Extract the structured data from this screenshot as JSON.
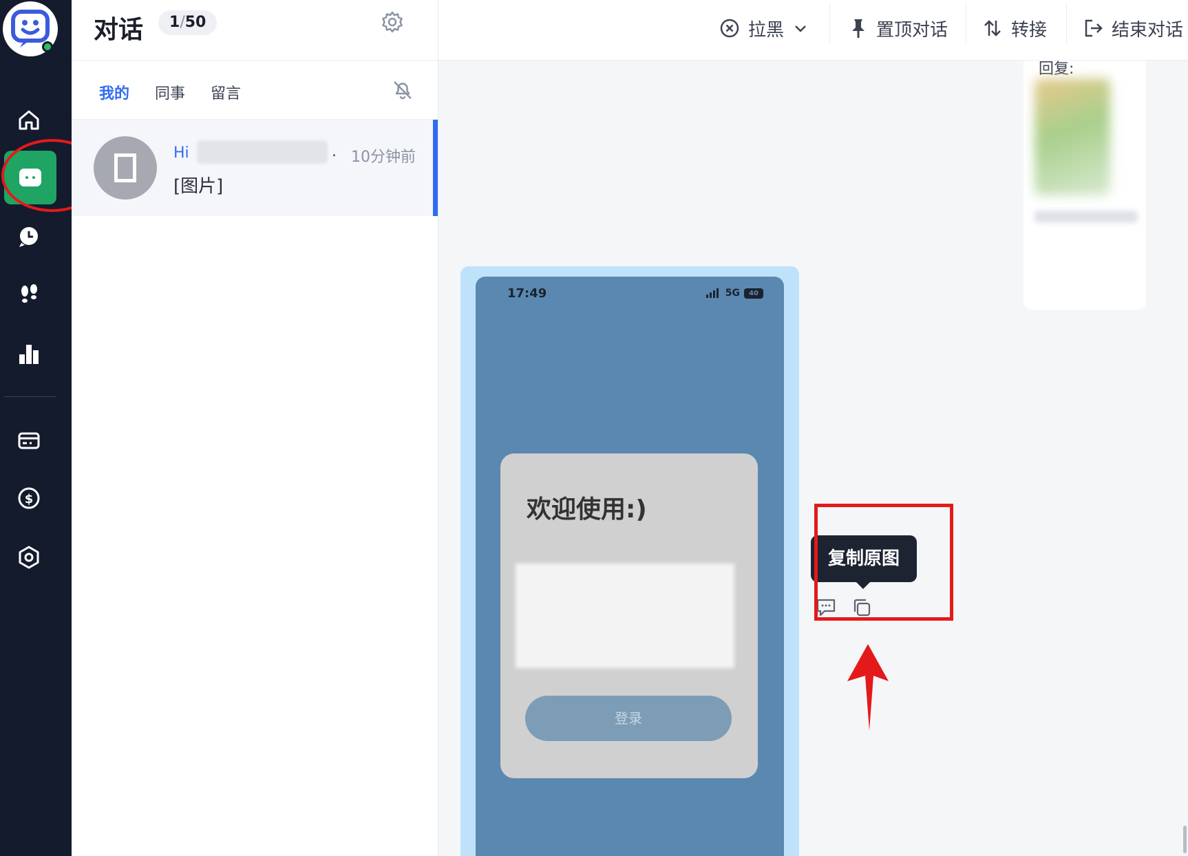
{
  "rail": {
    "logo_icon": "smiley-chat-logo",
    "items": [
      {
        "icon": "home-icon"
      },
      {
        "icon": "chat-icon",
        "active": true
      },
      {
        "icon": "history-icon"
      },
      {
        "icon": "footprints-icon"
      },
      {
        "icon": "bar-chart-icon"
      },
      {
        "icon": "card-icon"
      },
      {
        "icon": "dollar-icon"
      },
      {
        "icon": "settings-hex-icon"
      }
    ],
    "accent": "#1fa463"
  },
  "list": {
    "title": "对话",
    "count_current": "1",
    "count_sep": "/",
    "count_total": "50",
    "tabs": [
      "我的",
      "同事",
      "留言"
    ],
    "active_tab": "我的",
    "conversation": {
      "name": "Hi",
      "dot": ".",
      "time": "10分钟前",
      "last_message": "[图片]"
    }
  },
  "toolbar": {
    "blacklist_label": "拉黑",
    "pin_label": "置顶对话",
    "transfer_label": "转接",
    "end_label": "结束对话"
  },
  "chat": {
    "prev_partial_text": "回复:",
    "phone": {
      "time": "17:49",
      "network": "5G",
      "battery": "40",
      "dialog_title": "欢迎使用:)",
      "login_button": "登录"
    },
    "tooltip": "复制原图"
  },
  "colors": {
    "primary_blue": "#2f6bf2",
    "annotation_red": "#e41a1a",
    "tooltip_bg": "#1d2331"
  }
}
